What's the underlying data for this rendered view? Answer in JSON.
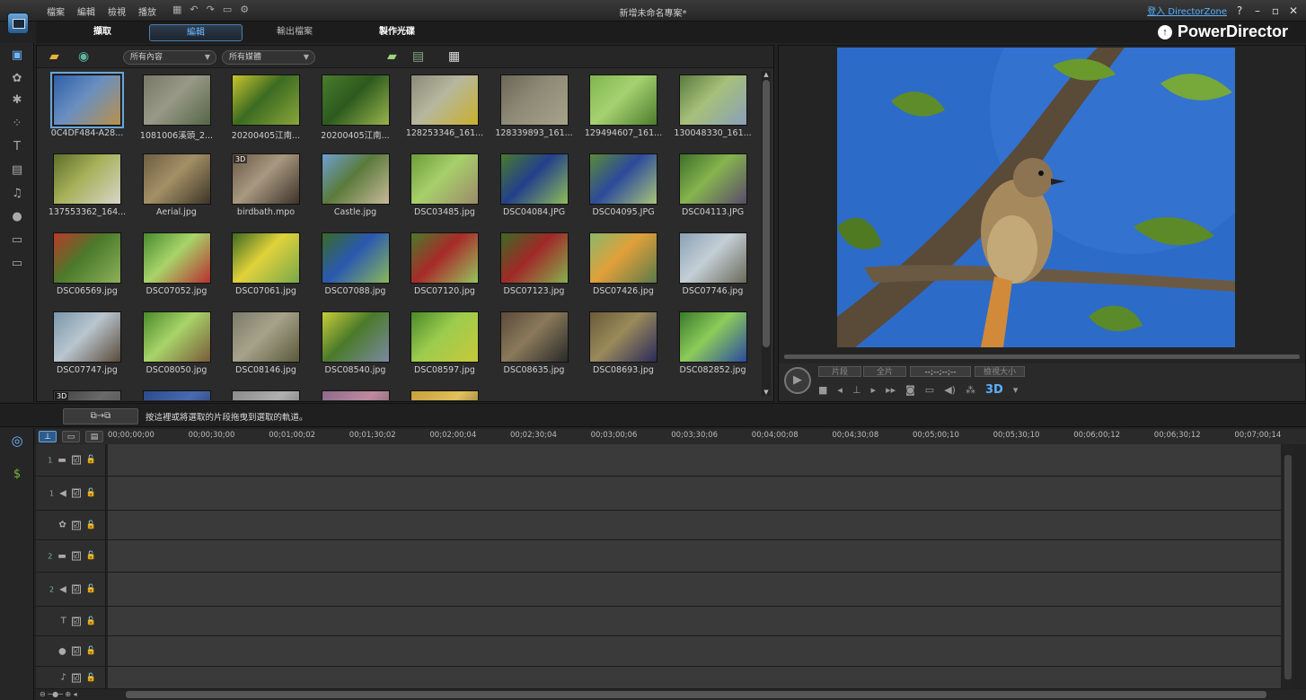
{
  "window": {
    "menu": [
      "檔案",
      "編輯",
      "檢視",
      "播放"
    ],
    "document_title": "新增未命名專案*",
    "director_zone_link": "登入 DirectorZone",
    "help": "?",
    "minimize": "–",
    "restore": "▫",
    "close": "✕"
  },
  "modes": {
    "capture": "擷取",
    "edit": "編輯",
    "produce": "輸出檔案",
    "create_disc": "製作光碟",
    "active": "edit"
  },
  "brand": {
    "name": "PowerDirector"
  },
  "library": {
    "filter_content": "所有內容",
    "filter_media": "所有媒體",
    "items": [
      {
        "name": "0C4DF484-A28...",
        "colors": [
          "#2e5fa8",
          "#6a8fc0",
          "#b8914a"
        ],
        "selected": true
      },
      {
        "name": "1081006溪頭_2...",
        "colors": [
          "#777766",
          "#999988",
          "#556644"
        ]
      },
      {
        "name": "20200405江南...",
        "colors": [
          "#c9c52e",
          "#3c6b21",
          "#8aa53a"
        ]
      },
      {
        "name": "20200405江南...",
        "colors": [
          "#4a7c2e",
          "#2c5a1e",
          "#9ab34d"
        ]
      },
      {
        "name": "128253346_161...",
        "colors": [
          "#8a8a7a",
          "#b7b79e",
          "#c8b02a"
        ]
      },
      {
        "name": "128339893_161...",
        "colors": [
          "#6b6656",
          "#8f8a76",
          "#a7a289"
        ]
      },
      {
        "name": "129494607_161...",
        "colors": [
          "#7fb54d",
          "#a6d171",
          "#4c7d2c"
        ]
      },
      {
        "name": "130048330_161...",
        "colors": [
          "#5a7a3e",
          "#a7c07a",
          "#89a0b8"
        ]
      },
      {
        "name": "137553362_164...",
        "colors": [
          "#5e6e2a",
          "#a7b15a",
          "#d6d6c8"
        ]
      },
      {
        "name": "Aerial.jpg",
        "colors": [
          "#6d5e40",
          "#a49066",
          "#3c3528"
        ]
      },
      {
        "name": "birdbath.mpo",
        "colors": [
          "#6a5a48",
          "#a89880",
          "#3d3328"
        ],
        "badge": "3D"
      },
      {
        "name": "Castle.jpg",
        "colors": [
          "#6ea0d2",
          "#5a7a3a",
          "#c9b99a"
        ]
      },
      {
        "name": "DSC03485.jpg",
        "colors": [
          "#6b9c3a",
          "#a8d06a",
          "#9c8a6a"
        ]
      },
      {
        "name": "DSC04084.JPG",
        "colors": [
          "#4a7a2e",
          "#22408a",
          "#8fbc5a"
        ]
      },
      {
        "name": "DSC04095.JPG",
        "colors": [
          "#5a8a38",
          "#2c4a9a",
          "#a8c47a"
        ]
      },
      {
        "name": "DSC04113.JPG",
        "colors": [
          "#3f6f2a",
          "#86b44e",
          "#5a4a6a"
        ]
      },
      {
        "name": "DSC06569.jpg",
        "colors": [
          "#b83a2a",
          "#4a7a2a",
          "#8fb05a"
        ]
      },
      {
        "name": "DSC07052.jpg",
        "colors": [
          "#4a8a2e",
          "#a8d46a",
          "#b83030"
        ]
      },
      {
        "name": "DSC07061.jpg",
        "colors": [
          "#3c6a22",
          "#e0d23a",
          "#7aa84a"
        ]
      },
      {
        "name": "DSC07088.jpg",
        "colors": [
          "#3a6a26",
          "#2a58b0",
          "#8ab85a"
        ]
      },
      {
        "name": "DSC07120.jpg",
        "colors": [
          "#4a7a2a",
          "#a82a2a",
          "#96c45e"
        ]
      },
      {
        "name": "DSC07123.jpg",
        "colors": [
          "#3c6a24",
          "#a02828",
          "#86b04e"
        ]
      },
      {
        "name": "DSC07426.jpg",
        "colors": [
          "#8ab86a",
          "#e0a03a",
          "#5a7a4a"
        ]
      },
      {
        "name": "DSC07746.jpg",
        "colors": [
          "#8aa0b4",
          "#c4cfd6",
          "#6a6a5a"
        ]
      },
      {
        "name": "DSC07747.jpg",
        "colors": [
          "#7a96aa",
          "#b9c6cf",
          "#5a4a3a"
        ]
      },
      {
        "name": "DSC08050.jpg",
        "colors": [
          "#4a8a2a",
          "#a8d46a",
          "#7a5a3a"
        ]
      },
      {
        "name": "DSC08146.jpg",
        "colors": [
          "#7a7a6a",
          "#a7a28a",
          "#5a5a3a"
        ]
      },
      {
        "name": "DSC08540.jpg",
        "colors": [
          "#c8cc3a",
          "#4a7a2a",
          "#7a8aa0"
        ]
      },
      {
        "name": "DSC08597.jpg",
        "colors": [
          "#4a8a2a",
          "#9ccc4e",
          "#c8c83a"
        ]
      },
      {
        "name": "DSC08635.jpg",
        "colors": [
          "#5a4a3a",
          "#8a7a5a",
          "#2a2a2a"
        ]
      },
      {
        "name": "DSC08693.jpg",
        "colors": [
          "#6a5a3a",
          "#9a8a5a",
          "#2a2a5a"
        ]
      },
      {
        "name": "DSC082852.jpg",
        "colors": [
          "#3a7a2a",
          "#8ccc5a",
          "#2a4aa0"
        ]
      },
      {
        "name": "",
        "colors": [
          "#3c3c3c",
          "#6a6a6a",
          "#4a4a4a"
        ],
        "badge": "3D"
      },
      {
        "name": "",
        "colors": [
          "#2a4a8a",
          "#4a6ab0",
          "#1a2a4a"
        ]
      },
      {
        "name": "",
        "colors": [
          "#8a8a8a",
          "#b0b0b0",
          "#5a5a5a"
        ]
      },
      {
        "name": "",
        "colors": [
          "#8a6a8a",
          "#c08aa0",
          "#5a4a5a"
        ]
      },
      {
        "name": "",
        "colors": [
          "#c8a03a",
          "#e0c05a",
          "#5a4a2a"
        ]
      }
    ]
  },
  "preview": {
    "tab_clip": "片段",
    "tab_movie": "全片",
    "timecode": "--;--;--;--",
    "view_size": "檢視大小",
    "mode_3d": "3D"
  },
  "hint": {
    "insert_button": "⧉→⧉",
    "text": "按這裡或將選取的片段拖曳到選取的軌道。"
  },
  "timeline": {
    "ruler": [
      "00;00;00;00",
      "00;00;30;00",
      "00;01;00;02",
      "00;01;30;02",
      "00;02;00;04",
      "00;02;30;04",
      "00;03;00;06",
      "00;03;30;06",
      "00;04;00;08",
      "00;04;30;08",
      "00;05;00;10",
      "00;05;30;10",
      "00;06;00;12",
      "00;06;30;12",
      "00;07;00;14"
    ],
    "tracks": [
      {
        "index": "1",
        "icon": "▬",
        "kind": "video-track"
      },
      {
        "index": "1",
        "icon": "◀",
        "kind": "audio-track"
      },
      {
        "index": "",
        "icon": "✿",
        "kind": "fx-track"
      },
      {
        "index": "2",
        "icon": "▬",
        "kind": "video-track"
      },
      {
        "index": "2",
        "icon": "◀",
        "kind": "audio-track"
      },
      {
        "index": "",
        "icon": "T",
        "kind": "title-track"
      },
      {
        "index": "",
        "icon": "●",
        "kind": "voice-track"
      },
      {
        "index": "",
        "icon": "♪",
        "kind": "music-track"
      }
    ],
    "checkbox": "☑",
    "lock": "🔓"
  }
}
